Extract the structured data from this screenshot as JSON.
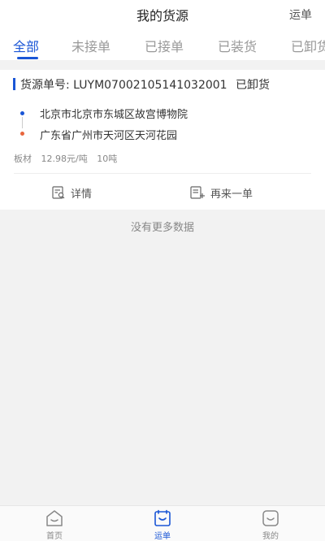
{
  "header": {
    "title": "我的货源",
    "right_link": "运单"
  },
  "tabs": [
    {
      "label": "全部",
      "active": true
    },
    {
      "label": "未接单",
      "active": false
    },
    {
      "label": "已接单",
      "active": false
    },
    {
      "label": "已装货",
      "active": false
    },
    {
      "label": "已卸货",
      "active": false
    }
  ],
  "order": {
    "number_label": "货源单号:",
    "number": "LUYM07002105141032001",
    "status": "已卸货",
    "from": "北京市北京市东城区故宫博物院",
    "to": "广东省广州市天河区天河花园",
    "cargo_type": "板材",
    "price": "12.98元/吨",
    "weight": "10吨",
    "actions": {
      "detail": "详情",
      "reorder": "再来一单"
    }
  },
  "list_end_text": "没有更多数据",
  "tabbar": [
    {
      "label": "首页",
      "icon": "home-icon",
      "active": false
    },
    {
      "label": "运单",
      "icon": "waybill-icon",
      "active": true
    },
    {
      "label": "我的",
      "icon": "profile-icon",
      "active": false
    }
  ],
  "colors": {
    "accent": "#1a56d6",
    "destination_dot": "#e8663d",
    "background": "#f2f2f2"
  }
}
